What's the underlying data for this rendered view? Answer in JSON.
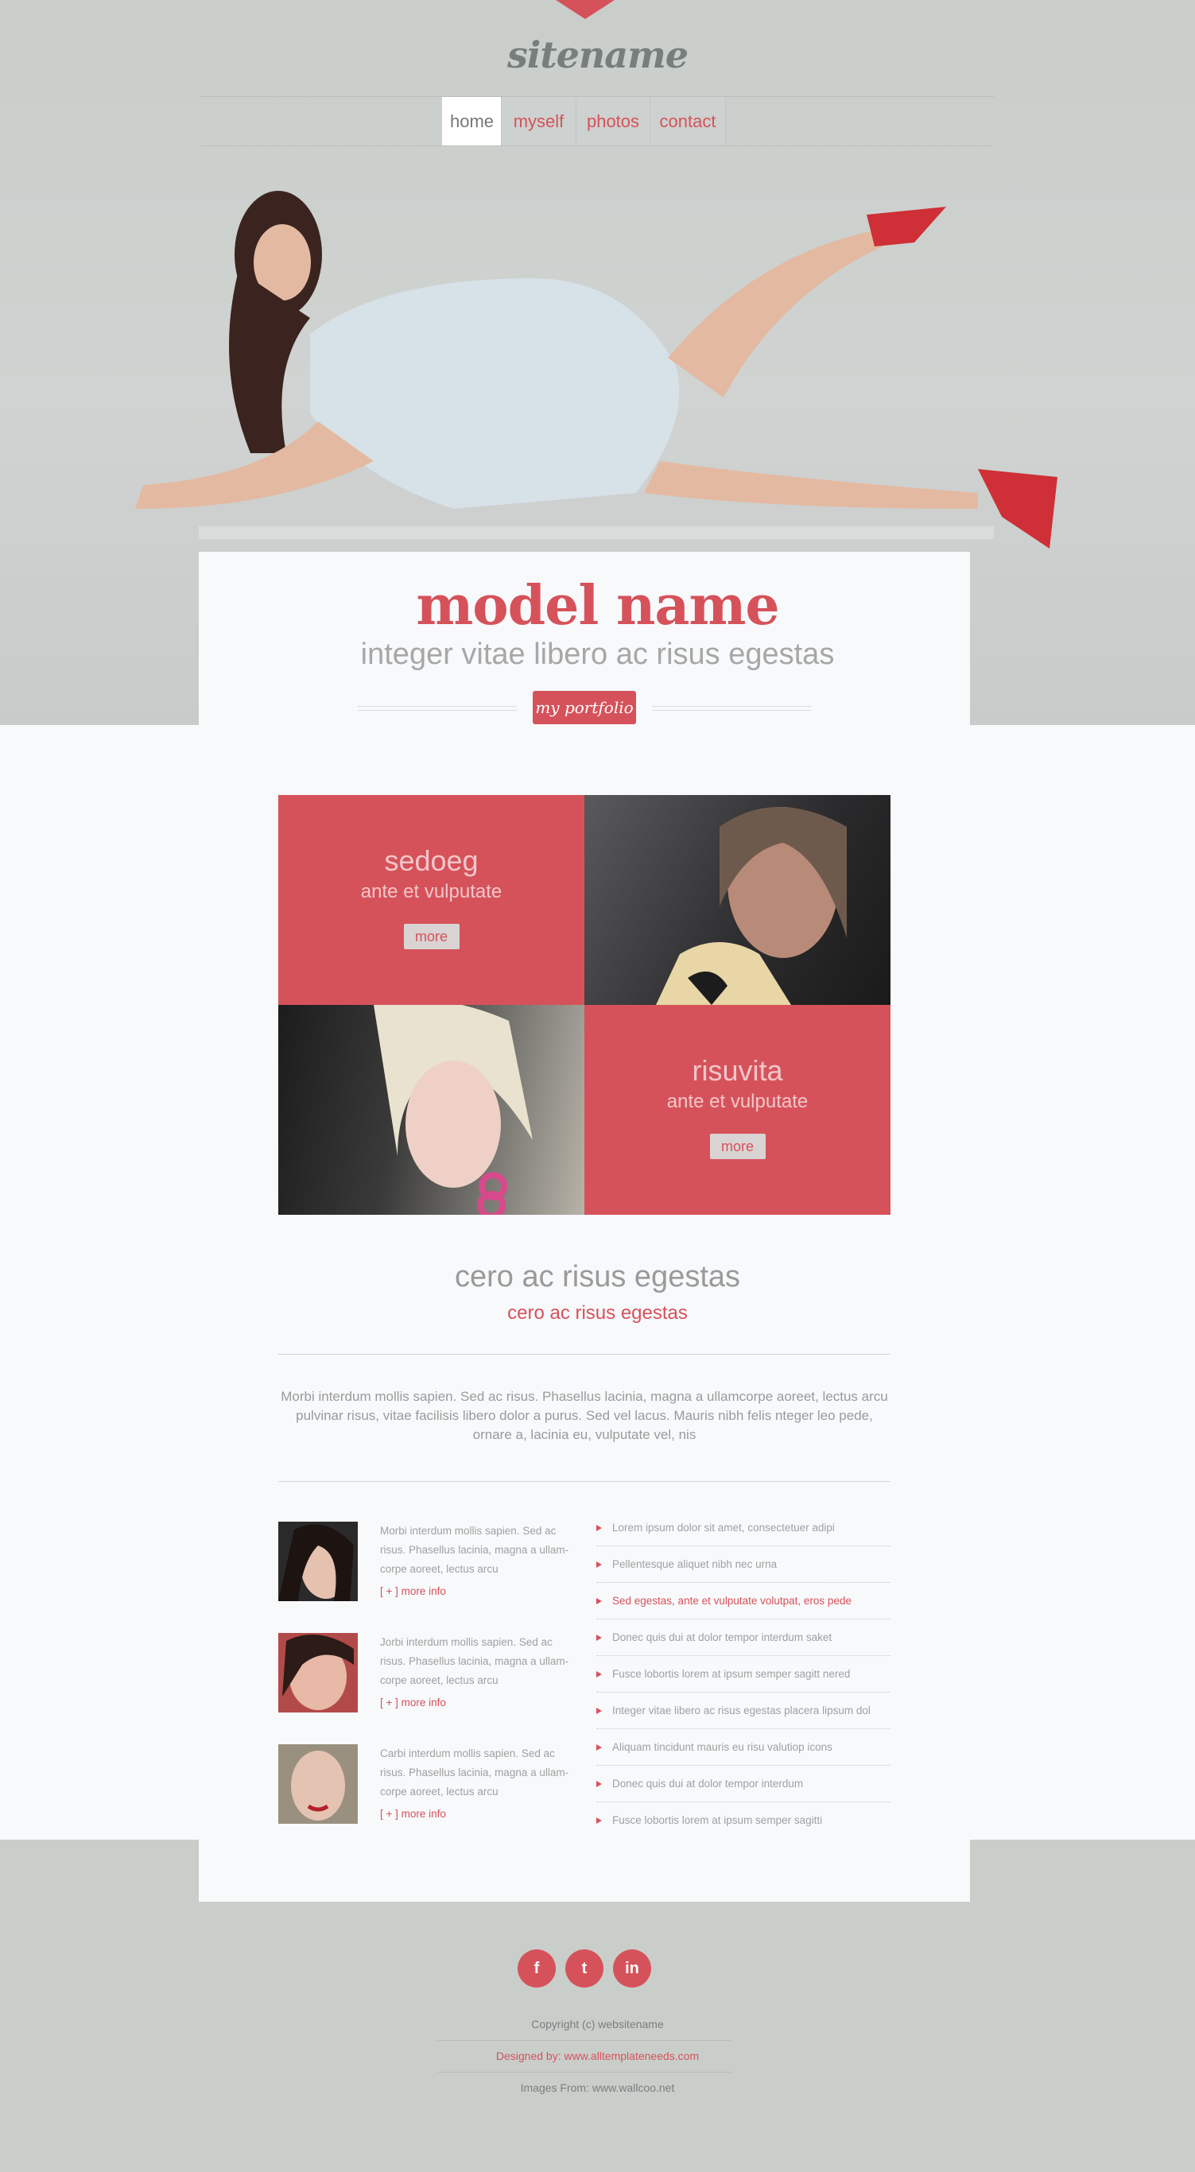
{
  "site": {
    "name": "sitename"
  },
  "nav": [
    {
      "label": "home",
      "active": true
    },
    {
      "label": "myself"
    },
    {
      "label": "photos"
    },
    {
      "label": "contact"
    }
  ],
  "hero": {
    "title": "model name",
    "subtitle": "integer vitae libero ac risus egestas",
    "button": "my portfolio"
  },
  "tiles": [
    {
      "title": "sedoeg",
      "sub": "ante et vulputate",
      "more": "more"
    },
    {
      "title": "risuvita",
      "sub": "ante et vulputate",
      "more": "more"
    }
  ],
  "section": {
    "title": "cero ac risus egestas",
    "subtitle": "cero ac risus egestas",
    "paragraph": "Morbi interdum mollis sapien. Sed ac risus. Phasellus lacinia, magna a ullamcorpe aoreet, lectus arcu pulvinar risus, vitae facilisis libero dolor a purus. Sed vel lacus. Mauris nibh felis nteger leo pede, ornare a, lacinia eu, vulputate vel, nis"
  },
  "posts": [
    {
      "text": "Morbi interdum mollis sapien. Sed ac risus. Phasellus lacinia, magna a ullam-corpe aoreet, lectus arcu",
      "more": "[ + ] more info"
    },
    {
      "text": "Jorbi interdum mollis sapien. Sed ac risus. Phasellus lacinia, magna a ullam-corpe aoreet, lectus arcu",
      "more": "[ + ] more info"
    },
    {
      "text": "Carbi interdum mollis sapien. Sed ac risus. Phasellus lacinia, magna a ullam-corpe aoreet, lectus arcu",
      "more": "[ + ] more info"
    }
  ],
  "links": [
    "Lorem ipsum dolor sit amet, consectetuer adipi",
    "Pellentesque aliquet nibh nec urna",
    "Sed egestas, ante et vulputate volutpat, eros pede",
    "Donec quis dui at dolor tempor interdum saket",
    "Fusce lobortis lorem at ipsum semper sagitt nered",
    "Integer vitae libero ac risus egestas placera lipsum dol",
    "Aliquam tincidunt mauris eu risu valutiop icons",
    "Donec quis dui at dolor tempor interdum",
    "Fusce lobortis lorem at ipsum semper sagitti"
  ],
  "social": [
    {
      "icon": "facebook-icon",
      "glyph": "f"
    },
    {
      "icon": "twitter-icon",
      "glyph": "t"
    },
    {
      "icon": "linkedin-icon",
      "glyph": "in"
    }
  ],
  "footer": {
    "copyright": "Copyright (c) websitename",
    "designed": "Designed by: www.alltemplateneeds.com",
    "images": "Images From: www.wallcoo.net"
  },
  "colors": {
    "accent": "#d6525b",
    "background": "#c9ceca",
    "panel": "#f7f9fb"
  }
}
